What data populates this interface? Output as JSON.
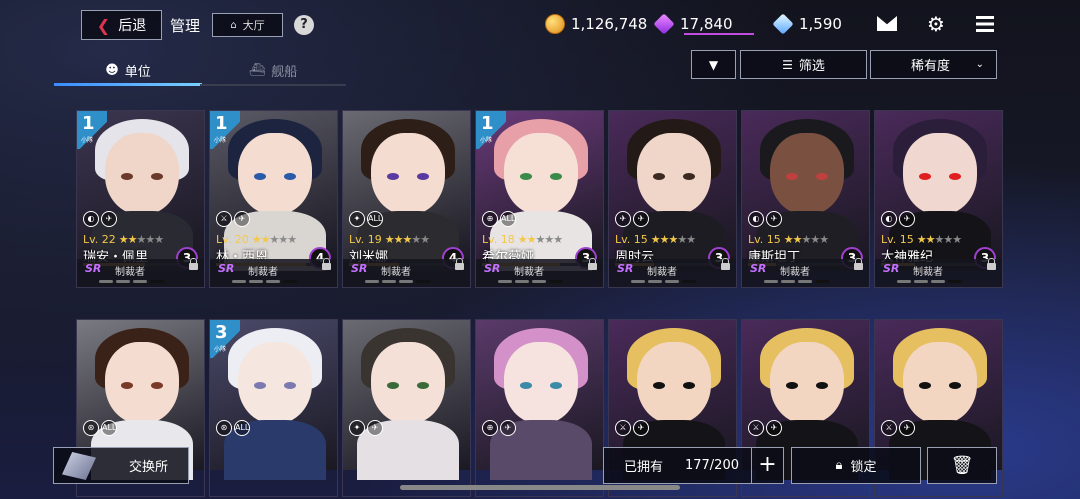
{
  "header": {
    "back_label": "后退",
    "title": "管理",
    "lobby_label": "大厅",
    "help_label": "?",
    "currencies": [
      {
        "icon": "gold-coin-icon",
        "value": "1,126,748"
      },
      {
        "icon": "purple-gem-icon",
        "value": "17,840"
      },
      {
        "icon": "diamond-icon",
        "value": "1,590"
      }
    ],
    "icons": [
      "mail-icon",
      "gear-icon",
      "menu-icon"
    ]
  },
  "tabs": [
    {
      "label": "单位",
      "active": true
    },
    {
      "label": "舰船",
      "active": false
    }
  ],
  "toolbar": {
    "filter_label": "筛选",
    "sort_label": "稀有度"
  },
  "units": [
    {
      "rank": "1",
      "rank_sub": "小隊",
      "roles": "◐ ✈",
      "level": "Lv. 22",
      "stars": 2,
      "name": "瑞安・佩里",
      "exp": 0.55,
      "count": "3",
      "rarity": "SR",
      "role": "制裁者",
      "hair": "#e4e4ea",
      "skin": "#f0d6c8",
      "eye": "#6a3a2a",
      "bg": "#3c3550",
      "cloth": "#2a2a33"
    },
    {
      "rank": "1",
      "rank_sub": "小隊",
      "roles": "⚔ ✈",
      "level": "Lv. 20",
      "stars": 2,
      "name": "林・西恩",
      "exp": 0.8,
      "count": "4",
      "rarity": "SR",
      "role": "制裁者",
      "hair": "#1d2440",
      "skin": "#f4ddd0",
      "eye": "#2a5aa8",
      "bg": "#5a5a66",
      "cloth": "#d9d6d2"
    },
    {
      "rank": "",
      "rank_sub": "",
      "roles": "✦ ALL",
      "level": "Lv. 19",
      "stars": 3,
      "name": "刘米娜",
      "exp": 0.45,
      "count": "4",
      "rarity": "SR",
      "role": "制裁者",
      "hair": "#2e1e18",
      "skin": "#f4dcd0",
      "eye": "#5a3aa0",
      "bg": "#6a6a72",
      "cloth": "#2c2c30"
    },
    {
      "rank": "1",
      "rank_sub": "小隊",
      "roles": "⊕ ALL",
      "level": "Lv. 18",
      "stars": 2,
      "name": "希尔薇娅",
      "exp": 0.7,
      "count": "3",
      "rarity": "SR",
      "role": "制裁者",
      "hair": "#e8a0a8",
      "skin": "#f6e0d6",
      "eye": "#3a8a4a",
      "bg": "#6a3a7a",
      "cloth": "#e8e4e4"
    },
    {
      "rank": "",
      "rank_sub": "",
      "roles": "✈ ✈",
      "level": "Lv. 15",
      "stars": 3,
      "name": "周时云",
      "exp": 0.35,
      "count": "3",
      "rarity": "SR",
      "role": "制裁者",
      "hair": "#231a18",
      "skin": "#f0d6c8",
      "eye": "#3a2a22",
      "bg": "#4a2a5a",
      "cloth": "#1c1c22"
    },
    {
      "rank": "",
      "rank_sub": "",
      "roles": "◐ ✈",
      "level": "Lv. 15",
      "stars": 2,
      "name": "康斯坦丁",
      "exp": 0.25,
      "count": "3",
      "rarity": "SR",
      "role": "制裁者",
      "hair": "#1a1a1e",
      "skin": "#7a5040",
      "eye": "#c04040",
      "bg": "#4a2a5a",
      "cloth": "#1e1e24"
    },
    {
      "rank": "",
      "rank_sub": "",
      "roles": "◐ ✈",
      "level": "Lv. 15",
      "stars": 2,
      "name": "大神雅纪",
      "exp": 0.3,
      "count": "3",
      "rarity": "SR",
      "role": "制裁者",
      "hair": "#2a1e3a",
      "skin": "#f0d8d0",
      "eye": "#e02020",
      "bg": "#4a2a5a",
      "cloth": "#141418"
    },
    {
      "rank": "",
      "rank_sub": "",
      "roles": "⊛ ALL",
      "level": "",
      "stars": 0,
      "name": "",
      "exp": 0,
      "count": "",
      "rarity": "",
      "role": "",
      "hair": "#3a2218",
      "skin": "#f4dcd0",
      "eye": "#7a3a2a",
      "bg": "#7a7a82",
      "cloth": "#e8e8ec"
    },
    {
      "rank": "3",
      "rank_sub": "小隊",
      "roles": "⊛ ALL",
      "level": "",
      "stars": 0,
      "name": "",
      "exp": 0,
      "count": "",
      "rarity": "",
      "role": "",
      "hair": "#eceef4",
      "skin": "#f6e6e0",
      "eye": "#7a7ab0",
      "bg": "#4a4a6a",
      "cloth": "#2a3a6a"
    },
    {
      "rank": "",
      "rank_sub": "",
      "roles": "✦ ✈",
      "level": "",
      "stars": 0,
      "name": "",
      "exp": 0,
      "count": "",
      "rarity": "",
      "role": "",
      "hair": "#3a3430",
      "skin": "#f4e0d6",
      "eye": "#3a6a3a",
      "bg": "#6a6a72",
      "cloth": "#e4e0e4"
    },
    {
      "rank": "",
      "rank_sub": "",
      "roles": "⊕ ✈",
      "level": "",
      "stars": 0,
      "name": "",
      "exp": 0,
      "count": "",
      "rarity": "",
      "role": "",
      "hair": "#d490c8",
      "skin": "#f6e2de",
      "eye": "#3a8aa8",
      "bg": "#5a3a6a",
      "cloth": "#5a4a6a"
    },
    {
      "rank": "",
      "rank_sub": "",
      "roles": "⚔ ✈",
      "level": "",
      "stars": 0,
      "name": "",
      "exp": 0,
      "count": "",
      "rarity": "",
      "role": "",
      "hair": "#e6c060",
      "skin": "#f2d6c2",
      "eye": "#111111",
      "bg": "#4a2a5a",
      "cloth": "#141418"
    },
    {
      "rank": "",
      "rank_sub": "",
      "roles": "⚔ ✈",
      "level": "",
      "stars": 0,
      "name": "",
      "exp": 0,
      "count": "",
      "rarity": "",
      "role": "",
      "hair": "#e6c060",
      "skin": "#f2d6c2",
      "eye": "#111111",
      "bg": "#4a2a5a",
      "cloth": "#141418"
    },
    {
      "rank": "",
      "rank_sub": "",
      "roles": "⚔ ✈",
      "level": "",
      "stars": 0,
      "name": "",
      "exp": 0,
      "count": "",
      "rarity": "",
      "role": "",
      "hair": "#e6c060",
      "skin": "#f2d6c2",
      "eye": "#111111",
      "bg": "#4a2a5a",
      "cloth": "#141418"
    }
  ],
  "footer": {
    "exchange_label": "交换所",
    "owned_label": "已拥有",
    "owned_count": "177/200",
    "plus_label": "+",
    "lock_label": "锁定"
  }
}
